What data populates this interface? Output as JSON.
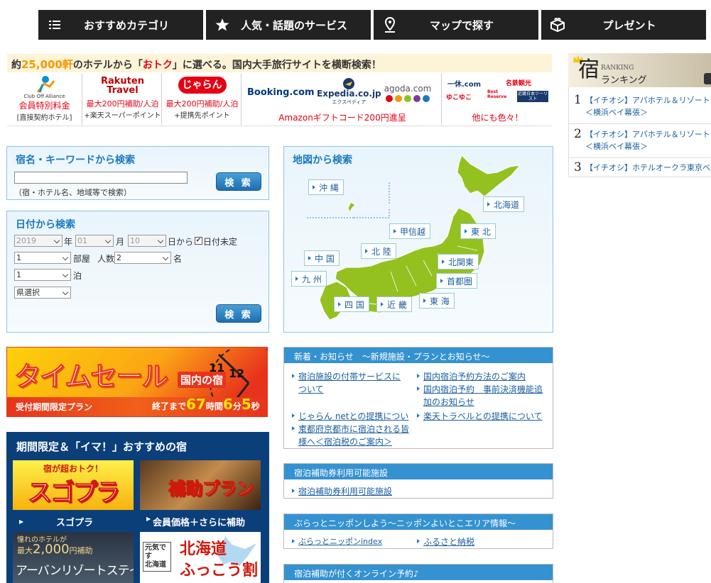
{
  "nav": [
    {
      "label": "おすすめカテゴリ",
      "icon": "list-icon"
    },
    {
      "label": "人気・話題のサービス",
      "icon": "star-icon"
    },
    {
      "label": "マップで探す",
      "icon": "map-pin-icon"
    },
    {
      "label": "プレゼント",
      "icon": "gift-icon"
    }
  ],
  "promo": {
    "pre": "約",
    "count": "25,000軒",
    "mid": "のホテルから「",
    "otoku": "おトク",
    "post": "」に選べる。国内大手旅行サイトを横断検索！",
    "cells": [
      {
        "logo": "Club Off Alliance",
        "line1": "会員特別料金",
        "line2": "[直接契約ホテル]"
      },
      {
        "logo1": "Rakuten",
        "logo2": "Travel",
        "line1": "最大200円補助/人泊",
        "line2": "+楽天スーパーポイント"
      },
      {
        "logo": "じゃらん",
        "line1": "最大200円補助/人泊",
        "line2": "+提携先ポイント"
      },
      {
        "logos": [
          "Booking.com",
          "Expedia.co.jp",
          "agoda.com"
        ],
        "expedia_sub": "エクスペディア",
        "line1": "Amazonギフトコード200円進呈"
      },
      {
        "logos": [
          "一休.com",
          "名鉄観光",
          "ゆこゆこ",
          "Best Reserve",
          "近畿日本ツーリスト"
        ],
        "line1": "他にも色々！"
      }
    ]
  },
  "keyword_search": {
    "title": "宿名・キーワードから検索",
    "value": "",
    "hint": "（宿・ホテル名、地域等で検索）",
    "button": "検 索"
  },
  "date_search": {
    "title": "日付から検索",
    "year": "2019",
    "year_unit": "年",
    "month": "01",
    "month_unit": "月",
    "day": "10",
    "day_unit": "日から",
    "undecided": "日付未定",
    "rooms": "1",
    "rooms_unit": "部屋",
    "people_label": "人数",
    "people": "2",
    "people_unit": "名",
    "nights": "1",
    "nights_unit": "泊",
    "pref": "県選択",
    "button": "検 索"
  },
  "map_search": {
    "title": "地図から検索",
    "regions": {
      "okinawa": "沖 縄",
      "hokkaido": "北海道",
      "koshinetsu": "甲信越",
      "tohoku": "東 北",
      "chugoku": "中 国",
      "hokuriku": "北 陸",
      "kitakanto": "北関東",
      "kyushu": "九 州",
      "shutoken": "首都圏",
      "shikoku": "四 国",
      "kinki": "近 畿",
      "tokai": "東 海"
    }
  },
  "timesale": {
    "title": "タイムセール",
    "badge": "国内の宿",
    "sub": "受付期間限定プラン",
    "remain_pre": "終了まで",
    "hours": "67",
    "h_unit": "時間",
    "minutes": "6",
    "m_unit": "分",
    "seconds": "5",
    "s_unit": "秒"
  },
  "recommend": {
    "title": "期間限定＆「イマ！」おすすめの宿",
    "items": [
      {
        "top": "宿が超おトク！",
        "big": "スゴプラ",
        "caption": "スゴプラ"
      },
      {
        "big": "補助プラン",
        "caption": "会員価格＋さらに補助"
      },
      {
        "top1": "憧れのホテルが",
        "top2": "最大",
        "amount": "2,000",
        "unit": "円補助",
        "big": "アーバンリゾートステイ"
      },
      {
        "side1": "元気です",
        "side2": "北海道",
        "big1": "北海道",
        "big2": "ふっこう割"
      }
    ]
  },
  "news": {
    "head": "新着・お知らせ　～新規施設・プランとお知らせ～",
    "links": [
      "宿泊施設の付帯サービスについて",
      "国内宿泊予約方法のご案内",
      "国内宿泊予約　事前決済機能追加のお知らせ",
      "じゃらん netとの提携について",
      "楽天トラベルとの提携について",
      "京都府京都市に宿泊される皆様へ＜宿泊税のご案内＞"
    ]
  },
  "subsidy": {
    "head": "宿泊補助券利用可能施設",
    "link": "宿泊補助券利用可能施設"
  },
  "nippon": {
    "head": "ぶらっとニッポンしよう～ニッポンよいとこエリア情報～",
    "links": [
      "ぶらっとニッポンindex",
      "ふるさと納税"
    ]
  },
  "online": {
    "head": "宿泊補助が付くオンライン予約♪"
  },
  "ranking": {
    "kanji": "宿",
    "en": "RANKING",
    "jp": "ランキング",
    "items": [
      {
        "num": "1",
        "text": "【イチオシ】アパホテル＆リゾート＜横浜ベイ幕張＞"
      },
      {
        "num": "2",
        "text": "【イチオシ】アパホテル＆リゾート＜横浜ベイ幕張＞"
      },
      {
        "num": "3",
        "text": "【イチオシ】ホテルオークラ東京ベイ"
      }
    ]
  },
  "colors": {
    "nav_bg": "#222222",
    "accent_blue": "#1a7abf",
    "header_blue": "#3592d0",
    "promo_orange": "#f39800",
    "red": "#e60012",
    "map_green": "#94c11f"
  }
}
